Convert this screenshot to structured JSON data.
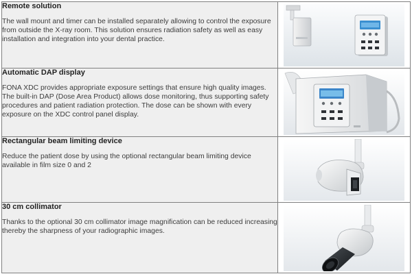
{
  "features": [
    {
      "title": "Remote solution",
      "description": "The wall mount and timer can be installed separately allowing to control the exposure from outside the X-ray room. This solution ensures radiation safety as well as easy installation and integration into your dental practice.",
      "image_icon": "wall-mount-timer-photo"
    },
    {
      "title": "Automatic DAP display",
      "description": "FONA XDC provides appropriate exposure settings that ensure high quality images. The built-in DAP (Dose Area Product) allows dose monitoring, thus supporting safety procedures and patient radiation protection. The dose can be shown with every exposure on the XDC control panel display.",
      "image_icon": "control-panel-display-photo"
    },
    {
      "title": "Rectangular beam limiting device",
      "description": "Reduce the patient dose by using the optional rectangular beam limiting device available in film size 0 and 2",
      "image_icon": "rectangular-collimator-photo"
    },
    {
      "title": "30 cm collimator",
      "description": "Thanks to the optional 30 cm collimator image magnification can be reduced increasing thereby the sharpness of your radiographic images.",
      "image_icon": "cone-collimator-photo"
    }
  ]
}
